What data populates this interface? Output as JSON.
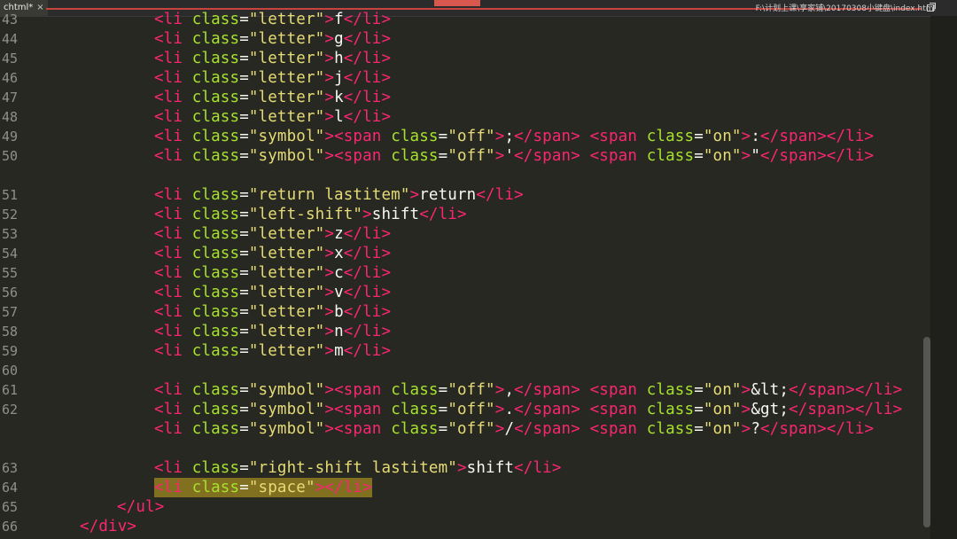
{
  "window": {
    "tab_title": "chtml*",
    "tab_close_glyph": "×",
    "file_path": "F:\\计划上课\\享家铺\\20170308小键盘\\index.html"
  },
  "editor": {
    "lines": [
      {
        "num": "43",
        "indent": 4,
        "tokens": [
          [
            "tag",
            "<li "
          ],
          [
            "attr",
            "class"
          ],
          [
            "punct",
            "="
          ],
          [
            "str",
            "\"letter\""
          ],
          [
            "tag",
            ">"
          ],
          [
            "txt",
            "f"
          ],
          [
            "tag",
            "</li>"
          ]
        ]
      },
      {
        "num": "44",
        "indent": 4,
        "tokens": [
          [
            "tag",
            "<li "
          ],
          [
            "attr",
            "class"
          ],
          [
            "punct",
            "="
          ],
          [
            "str",
            "\"letter\""
          ],
          [
            "tag",
            ">"
          ],
          [
            "txt",
            "g"
          ],
          [
            "tag",
            "</li>"
          ]
        ]
      },
      {
        "num": "45",
        "indent": 4,
        "tokens": [
          [
            "tag",
            "<li "
          ],
          [
            "attr",
            "class"
          ],
          [
            "punct",
            "="
          ],
          [
            "str",
            "\"letter\""
          ],
          [
            "tag",
            ">"
          ],
          [
            "txt",
            "h"
          ],
          [
            "tag",
            "</li>"
          ]
        ]
      },
      {
        "num": "46",
        "indent": 4,
        "tokens": [
          [
            "tag",
            "<li "
          ],
          [
            "attr",
            "class"
          ],
          [
            "punct",
            "="
          ],
          [
            "str",
            "\"letter\""
          ],
          [
            "tag",
            ">"
          ],
          [
            "txt",
            "j"
          ],
          [
            "tag",
            "</li>"
          ]
        ]
      },
      {
        "num": "47",
        "indent": 4,
        "tokens": [
          [
            "tag",
            "<li "
          ],
          [
            "attr",
            "class"
          ],
          [
            "punct",
            "="
          ],
          [
            "str",
            "\"letter\""
          ],
          [
            "tag",
            ">"
          ],
          [
            "txt",
            "k"
          ],
          [
            "tag",
            "</li>"
          ]
        ]
      },
      {
        "num": "48",
        "indent": 4,
        "tokens": [
          [
            "tag",
            "<li "
          ],
          [
            "attr",
            "class"
          ],
          [
            "punct",
            "="
          ],
          [
            "str",
            "\"letter\""
          ],
          [
            "tag",
            ">"
          ],
          [
            "txt",
            "l"
          ],
          [
            "tag",
            "</li>"
          ]
        ]
      },
      {
        "num": "49",
        "indent": 4,
        "tokens": [
          [
            "tag",
            "<li "
          ],
          [
            "attr",
            "class"
          ],
          [
            "punct",
            "="
          ],
          [
            "str",
            "\"symbol\""
          ],
          [
            "tag",
            ">"
          ],
          [
            "tag",
            "<span "
          ],
          [
            "attr",
            "class"
          ],
          [
            "punct",
            "="
          ],
          [
            "str",
            "\"off\""
          ],
          [
            "tag",
            ">"
          ],
          [
            "txt",
            ";"
          ],
          [
            "tag",
            "</span>"
          ],
          [
            "txt",
            " "
          ],
          [
            "tag",
            "<span "
          ],
          [
            "attr",
            "class"
          ],
          [
            "punct",
            "="
          ],
          [
            "str",
            "\"on\""
          ],
          [
            "tag",
            ">"
          ],
          [
            "txt",
            ":"
          ],
          [
            "tag",
            "</span></li>"
          ]
        ]
      },
      {
        "num": "50",
        "indent": 4,
        "tokens": [
          [
            "tag",
            "<li "
          ],
          [
            "attr",
            "class"
          ],
          [
            "punct",
            "="
          ],
          [
            "str",
            "\"symbol\""
          ],
          [
            "tag",
            ">"
          ],
          [
            "tag",
            "<span "
          ],
          [
            "attr",
            "class"
          ],
          [
            "punct",
            "="
          ],
          [
            "str",
            "\"off\""
          ],
          [
            "tag",
            ">"
          ],
          [
            "txt",
            "'"
          ],
          [
            "tag",
            "</span>"
          ],
          [
            "txt",
            " "
          ],
          [
            "tag",
            "<span "
          ],
          [
            "attr",
            "class"
          ],
          [
            "punct",
            "="
          ],
          [
            "str",
            "\"on\""
          ],
          [
            "tag",
            ">"
          ],
          [
            "txt",
            "\""
          ],
          [
            "tag",
            "</span></li>"
          ]
        ]
      },
      {
        "num": "",
        "indent": 0,
        "tokens": []
      },
      {
        "num": "51",
        "indent": 4,
        "tokens": [
          [
            "tag",
            "<li "
          ],
          [
            "attr",
            "class"
          ],
          [
            "punct",
            "="
          ],
          [
            "str",
            "\"return lastitem\""
          ],
          [
            "tag",
            ">"
          ],
          [
            "txt",
            "return"
          ],
          [
            "tag",
            "</li>"
          ]
        ]
      },
      {
        "num": "52",
        "indent": 4,
        "tokens": [
          [
            "tag",
            "<li "
          ],
          [
            "attr",
            "class"
          ],
          [
            "punct",
            "="
          ],
          [
            "str",
            "\"left-shift\""
          ],
          [
            "tag",
            ">"
          ],
          [
            "txt",
            "shift"
          ],
          [
            "tag",
            "</li>"
          ]
        ]
      },
      {
        "num": "53",
        "indent": 4,
        "tokens": [
          [
            "tag",
            "<li "
          ],
          [
            "attr",
            "class"
          ],
          [
            "punct",
            "="
          ],
          [
            "str",
            "\"letter\""
          ],
          [
            "tag",
            ">"
          ],
          [
            "txt",
            "z"
          ],
          [
            "tag",
            "</li>"
          ]
        ]
      },
      {
        "num": "54",
        "indent": 4,
        "tokens": [
          [
            "tag",
            "<li "
          ],
          [
            "attr",
            "class"
          ],
          [
            "punct",
            "="
          ],
          [
            "str",
            "\"letter\""
          ],
          [
            "tag",
            ">"
          ],
          [
            "txt",
            "x"
          ],
          [
            "tag",
            "</li>"
          ]
        ]
      },
      {
        "num": "55",
        "indent": 4,
        "tokens": [
          [
            "tag",
            "<li "
          ],
          [
            "attr",
            "class"
          ],
          [
            "punct",
            "="
          ],
          [
            "str",
            "\"letter\""
          ],
          [
            "tag",
            ">"
          ],
          [
            "txt",
            "c"
          ],
          [
            "tag",
            "</li>"
          ]
        ]
      },
      {
        "num": "56",
        "indent": 4,
        "tokens": [
          [
            "tag",
            "<li "
          ],
          [
            "attr",
            "class"
          ],
          [
            "punct",
            "="
          ],
          [
            "str",
            "\"letter\""
          ],
          [
            "tag",
            ">"
          ],
          [
            "txt",
            "v"
          ],
          [
            "tag",
            "</li>"
          ]
        ]
      },
      {
        "num": "57",
        "indent": 4,
        "tokens": [
          [
            "tag",
            "<li "
          ],
          [
            "attr",
            "class"
          ],
          [
            "punct",
            "="
          ],
          [
            "str",
            "\"letter\""
          ],
          [
            "tag",
            ">"
          ],
          [
            "txt",
            "b"
          ],
          [
            "tag",
            "</li>"
          ]
        ]
      },
      {
        "num": "58",
        "indent": 4,
        "tokens": [
          [
            "tag",
            "<li "
          ],
          [
            "attr",
            "class"
          ],
          [
            "punct",
            "="
          ],
          [
            "str",
            "\"letter\""
          ],
          [
            "tag",
            ">"
          ],
          [
            "txt",
            "n"
          ],
          [
            "tag",
            "</li>"
          ]
        ]
      },
      {
        "num": "59",
        "indent": 4,
        "tokens": [
          [
            "tag",
            "<li "
          ],
          [
            "attr",
            "class"
          ],
          [
            "punct",
            "="
          ],
          [
            "str",
            "\"letter\""
          ],
          [
            "tag",
            ">"
          ],
          [
            "txt",
            "m"
          ],
          [
            "tag",
            "</li>"
          ]
        ]
      },
      {
        "num": "60",
        "indent": 0,
        "tokens": []
      },
      {
        "num": "61",
        "indent": 4,
        "tokens": [
          [
            "tag",
            "<li "
          ],
          [
            "attr",
            "class"
          ],
          [
            "punct",
            "="
          ],
          [
            "str",
            "\"symbol\""
          ],
          [
            "tag",
            ">"
          ],
          [
            "tag",
            "<span "
          ],
          [
            "attr",
            "class"
          ],
          [
            "punct",
            "="
          ],
          [
            "str",
            "\"off\""
          ],
          [
            "tag",
            ">"
          ],
          [
            "txt",
            ","
          ],
          [
            "tag",
            "</span>"
          ],
          [
            "txt",
            " "
          ],
          [
            "tag",
            "<span "
          ],
          [
            "attr",
            "class"
          ],
          [
            "punct",
            "="
          ],
          [
            "str",
            "\"on\""
          ],
          [
            "tag",
            ">"
          ],
          [
            "txt",
            "&lt;"
          ],
          [
            "tag",
            "</span></li>"
          ]
        ]
      },
      {
        "num": "62",
        "indent": 4,
        "tokens": [
          [
            "tag",
            "<li "
          ],
          [
            "attr",
            "class"
          ],
          [
            "punct",
            "="
          ],
          [
            "str",
            "\"symbol\""
          ],
          [
            "tag",
            ">"
          ],
          [
            "tag",
            "<span "
          ],
          [
            "attr",
            "class"
          ],
          [
            "punct",
            "="
          ],
          [
            "str",
            "\"off\""
          ],
          [
            "tag",
            ">"
          ],
          [
            "txt",
            "."
          ],
          [
            "tag",
            "</span>"
          ],
          [
            "txt",
            " "
          ],
          [
            "tag",
            "<span "
          ],
          [
            "attr",
            "class"
          ],
          [
            "punct",
            "="
          ],
          [
            "str",
            "\"on\""
          ],
          [
            "tag",
            ">"
          ],
          [
            "txt",
            "&gt;"
          ],
          [
            "tag",
            "</span></li>"
          ]
        ]
      },
      {
        "num": "",
        "indent": 4,
        "tokens": [
          [
            "tag",
            "<li "
          ],
          [
            "attr",
            "class"
          ],
          [
            "punct",
            "="
          ],
          [
            "str",
            "\"symbol\""
          ],
          [
            "tag",
            ">"
          ],
          [
            "tag",
            "<span "
          ],
          [
            "attr",
            "class"
          ],
          [
            "punct",
            "="
          ],
          [
            "str",
            "\"off\""
          ],
          [
            "tag",
            ">"
          ],
          [
            "txt",
            "/"
          ],
          [
            "tag",
            "</span>"
          ],
          [
            "txt",
            " "
          ],
          [
            "tag",
            "<span "
          ],
          [
            "attr",
            "class"
          ],
          [
            "punct",
            "="
          ],
          [
            "str",
            "\"on\""
          ],
          [
            "tag",
            ">"
          ],
          [
            "txt",
            "?"
          ],
          [
            "tag",
            "</span></li>"
          ]
        ]
      },
      {
        "num": "",
        "indent": 0,
        "tokens": []
      },
      {
        "num": "63",
        "indent": 4,
        "tokens": [
          [
            "tag",
            "<li "
          ],
          [
            "attr",
            "class"
          ],
          [
            "punct",
            "="
          ],
          [
            "str",
            "\"right-shift lastitem\""
          ],
          [
            "tag",
            ">"
          ],
          [
            "txt",
            "shift"
          ],
          [
            "tag",
            "</li>"
          ]
        ]
      },
      {
        "num": "64",
        "indent": 4,
        "selected": true,
        "tokens": [
          [
            "tag",
            "<li "
          ],
          [
            "attr",
            "class"
          ],
          [
            "punct",
            "="
          ],
          [
            "str",
            "\"space\""
          ],
          [
            "tag",
            "></li>"
          ]
        ]
      },
      {
        "num": "65",
        "indent": 3,
        "tokens": [
          [
            "tag",
            "</ul>"
          ]
        ]
      },
      {
        "num": "66",
        "indent": 2,
        "tokens": [
          [
            "tag",
            "</div>"
          ]
        ]
      }
    ]
  },
  "colors": {
    "background": "#272822",
    "tag": "#f92672",
    "attribute": "#a6e22e",
    "string": "#e6db74",
    "text": "#f8f8f2",
    "line_number": "#8f908a",
    "selection": "#807020"
  },
  "icons": {
    "restore": "restore-window-icon"
  }
}
